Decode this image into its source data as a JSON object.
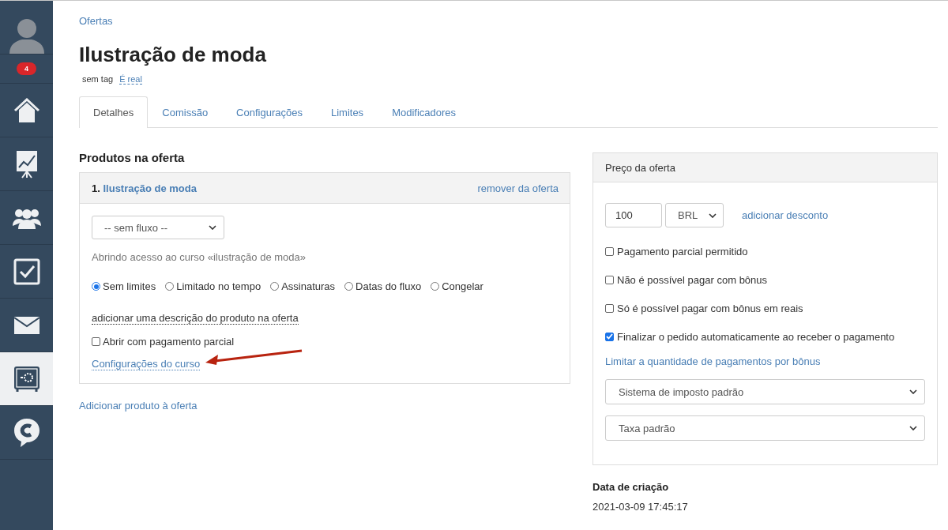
{
  "sidebar": {
    "notification_badge": "4",
    "items": [
      {
        "kind": "avatar",
        "selected": false
      },
      {
        "kind": "home",
        "selected": false
      },
      {
        "kind": "chart",
        "selected": false
      },
      {
        "kind": "people",
        "selected": false
      },
      {
        "kind": "tasks",
        "selected": false
      },
      {
        "kind": "mail",
        "selected": false
      },
      {
        "kind": "safe",
        "selected": true
      },
      {
        "kind": "chat",
        "selected": false
      }
    ]
  },
  "breadcrumb": "Ofertas",
  "title": "Ilustração de moda",
  "tags": {
    "tag": "sem tag",
    "real_link": "É real"
  },
  "tabs": [
    {
      "label": "Detalhes",
      "selected": true
    },
    {
      "label": "Comissão",
      "selected": false
    },
    {
      "label": "Configurações",
      "selected": false
    },
    {
      "label": "Limites",
      "selected": false
    },
    {
      "label": "Modificadores",
      "selected": false
    }
  ],
  "products": {
    "heading": "Produtos na oferta",
    "items": [
      {
        "number": "1.",
        "name": "Ilustração de moda",
        "remove_link": "remover da oferta",
        "flow_select": "-- sem fluxo --",
        "access_note": "Abrindo acesso ao curso «ilustração de moda»",
        "access_options": [
          {
            "label": "Sem limites",
            "selected": true
          },
          {
            "label": "Limitado no tempo",
            "selected": false
          },
          {
            "label": "Assinaturas",
            "selected": false
          },
          {
            "label": "Datas do fluxo",
            "selected": false
          },
          {
            "label": "Congelar",
            "selected": false
          }
        ],
        "description_link": "adicionar uma descrição do produto na oferta",
        "partial_payment": {
          "label": "Abrir com pagamento parcial",
          "checked": false
        },
        "settings_link": "Configurações do curso"
      }
    ],
    "add_link": "Adicionar produto à oferta"
  },
  "price": {
    "title": "Preço da oferta",
    "amount": "100",
    "currency": "BRL",
    "discount_link": "adicionar desconto",
    "options": [
      {
        "label": "Pagamento parcial permitido",
        "checked": false
      },
      {
        "label": "Não é possível pagar com bônus",
        "checked": false
      },
      {
        "label": "Só é possível pagar com bônus em reais",
        "checked": false
      },
      {
        "label": "Finalizar o pedido automaticamente ao receber o pagamento",
        "checked": true
      }
    ],
    "limit_link": "Limitar a quantidade de pagamentos por bônus",
    "selects": [
      "Sistema de imposto padrão",
      "Taxa padrão"
    ]
  },
  "created": {
    "label": "Data de criação",
    "value": "2021-03-09 17:45:17"
  }
}
